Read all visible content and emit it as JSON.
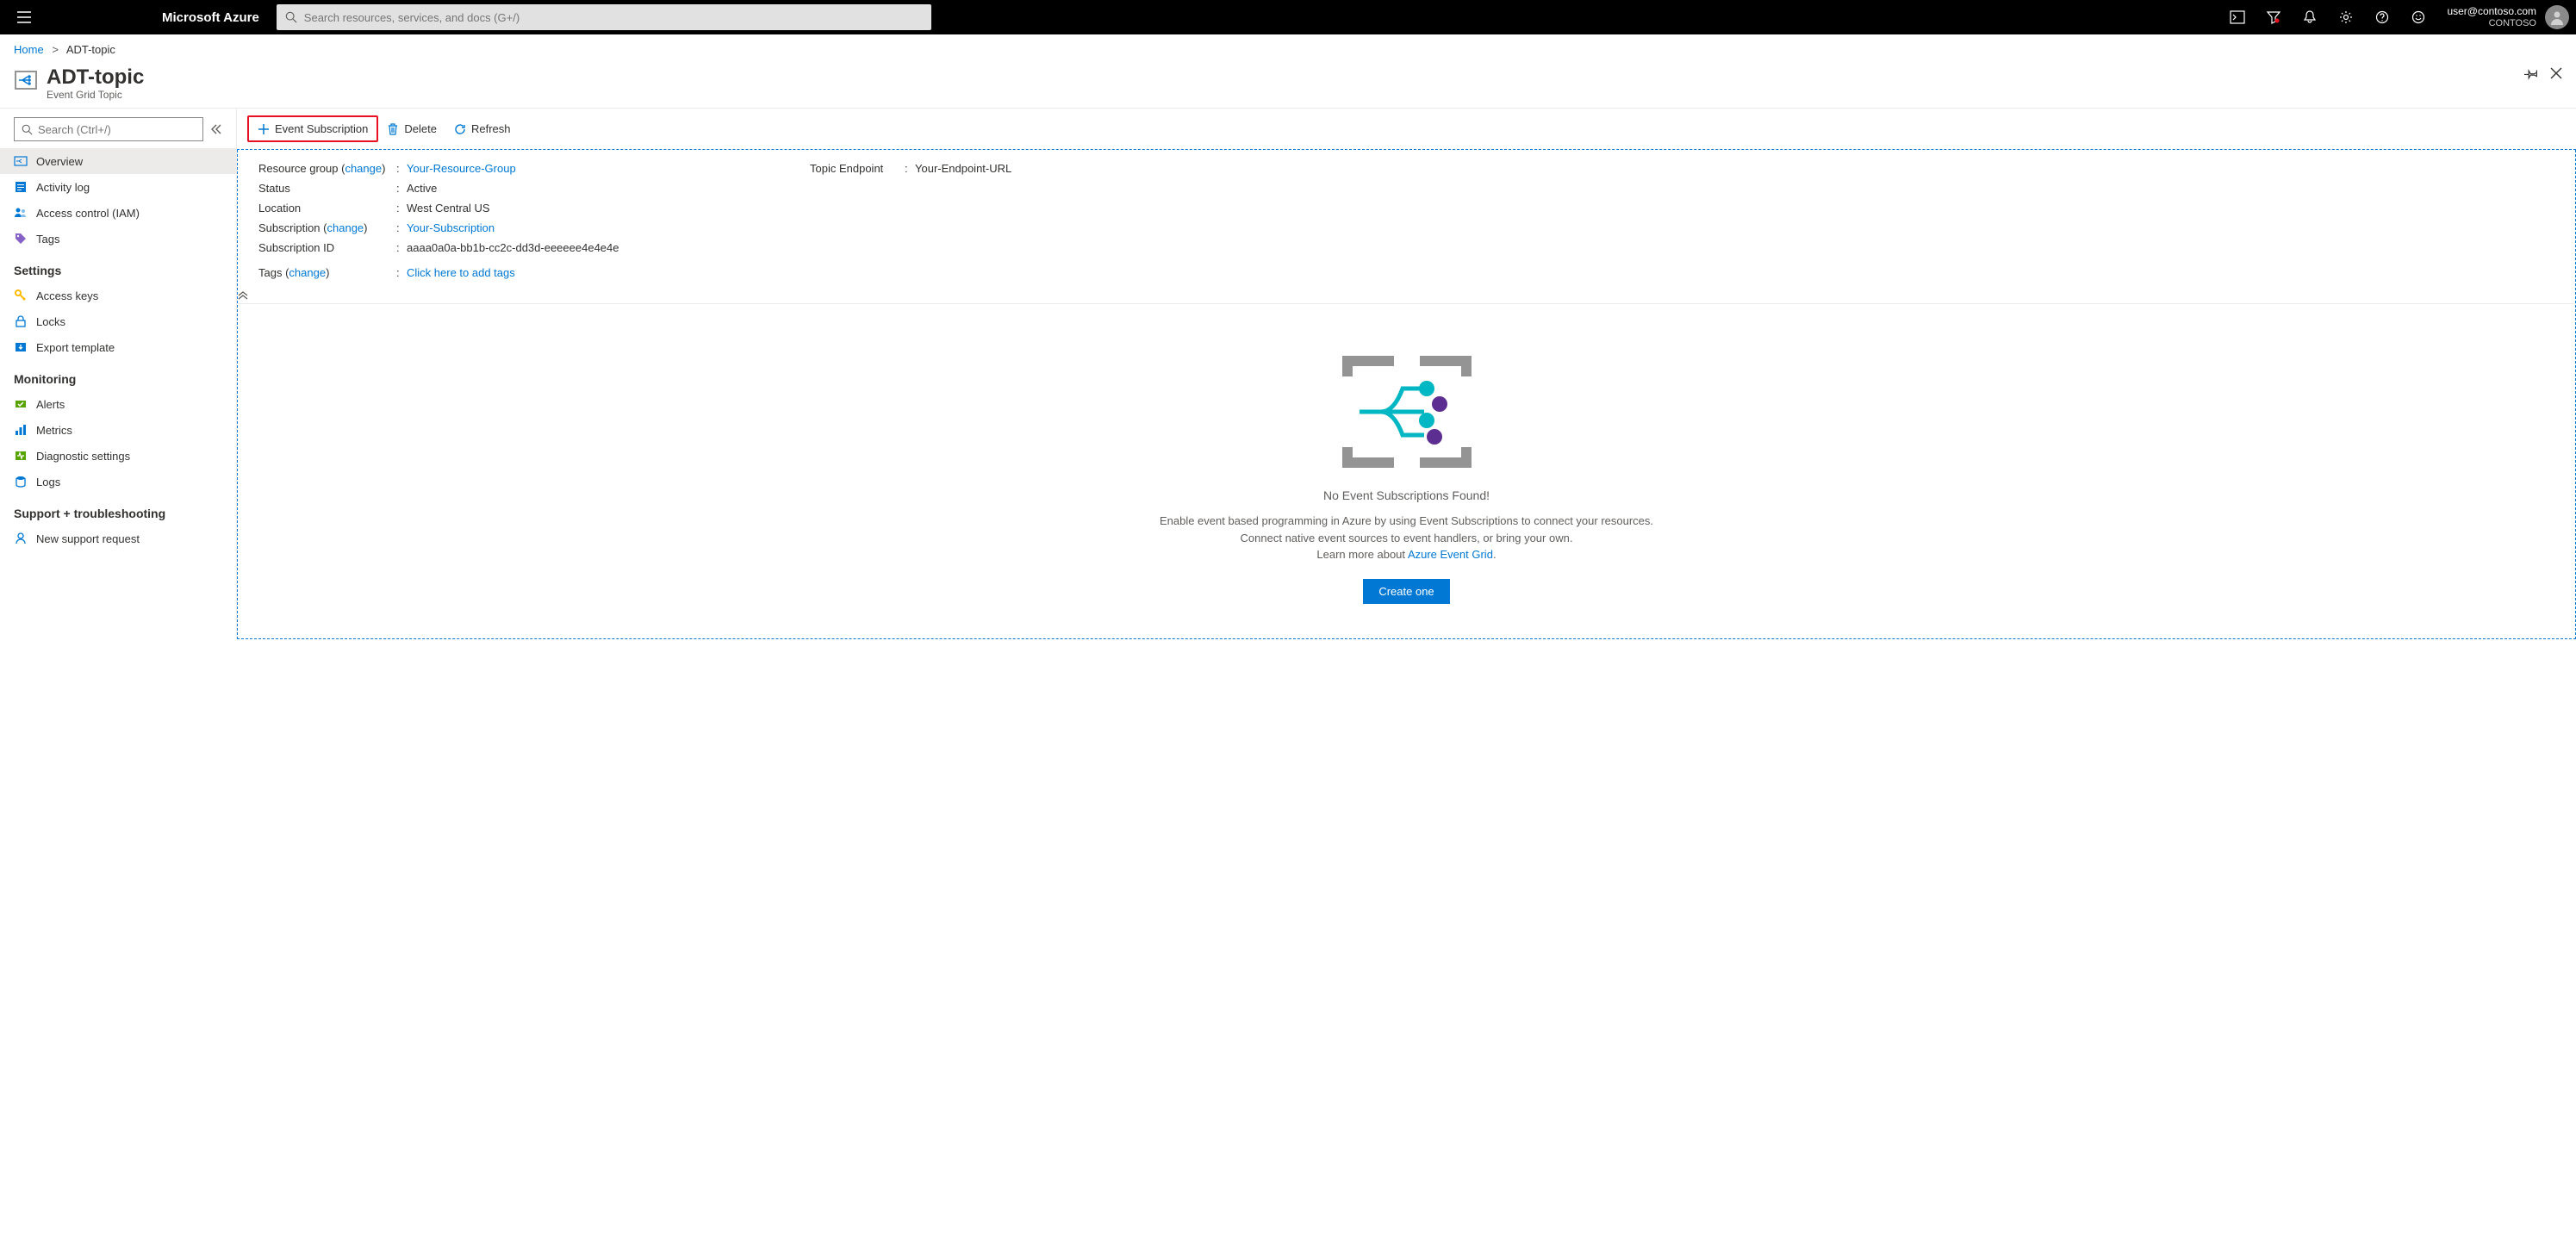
{
  "topbar": {
    "brand": "Microsoft Azure",
    "search_placeholder": "Search resources, services, and docs (G+/)",
    "user_email": "user@contoso.com",
    "user_tenant": "CONTOSO"
  },
  "breadcrumb": {
    "home": "Home",
    "current": "ADT-topic"
  },
  "header": {
    "title": "ADT-topic",
    "subtitle": "Event Grid Topic"
  },
  "sidebar": {
    "search_placeholder": "Search (Ctrl+/)",
    "items_top": [
      {
        "label": "Overview"
      },
      {
        "label": "Activity log"
      },
      {
        "label": "Access control (IAM)"
      },
      {
        "label": "Tags"
      }
    ],
    "group_settings": "Settings",
    "items_settings": [
      {
        "label": "Access keys"
      },
      {
        "label": "Locks"
      },
      {
        "label": "Export template"
      }
    ],
    "group_monitoring": "Monitoring",
    "items_monitoring": [
      {
        "label": "Alerts"
      },
      {
        "label": "Metrics"
      },
      {
        "label": "Diagnostic settings"
      },
      {
        "label": "Logs"
      }
    ],
    "group_support": "Support + troubleshooting",
    "items_support": [
      {
        "label": "New support request"
      }
    ]
  },
  "toolbar": {
    "event_sub": "Event Subscription",
    "delete": "Delete",
    "refresh": "Refresh"
  },
  "essentials": {
    "rg_label": "Resource group",
    "change": "change",
    "rg_value": "Your-Resource-Group",
    "status_label": "Status",
    "status_value": "Active",
    "location_label": "Location",
    "location_value": "West Central US",
    "sub_label": "Subscription",
    "sub_value": "Your-Subscription",
    "subid_label": "Subscription ID",
    "subid_value": "aaaa0a0a-bb1b-cc2c-dd3d-eeeeee4e4e4e",
    "tags_label": "Tags",
    "tags_value": "Click here to add tags",
    "endpoint_label": "Topic Endpoint",
    "endpoint_value": "Your-Endpoint-URL"
  },
  "empty": {
    "title": "No Event Subscriptions Found!",
    "desc1": "Enable event based programming in Azure by using Event Subscriptions to connect your resources.",
    "desc2": "Connect native event sources to event handlers, or bring your own.",
    "learn": "Learn more about ",
    "learn_link": "Azure Event Grid",
    "button": "Create one"
  }
}
